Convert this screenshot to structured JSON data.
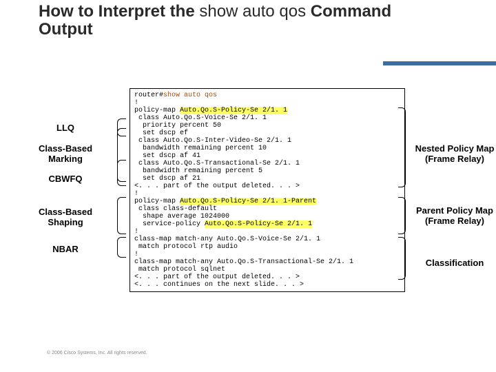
{
  "title": {
    "part1": "How to Interpret the ",
    "part2": "show auto qos ",
    "part3": "Command",
    "part4": "Output"
  },
  "leftLabels": {
    "llq": "LLQ",
    "marking": "Class-Based\nMarking",
    "cbwfq": "CBWFQ",
    "shaping": "Class-Based\nShaping",
    "nbar": "NBAR"
  },
  "rightLabels": {
    "nested": "Nested Policy Map\n(Frame Relay)",
    "parent": "Parent Policy Map\n(Frame Relay)",
    "classification": "Classification"
  },
  "code": {
    "l1a": "router#",
    "l1b": "show auto qos",
    "l2": "!",
    "l3a": "policy-map ",
    "l3b": "Auto.Qo.S-Policy-Se 2/1. 1",
    "l4": " class Auto.Qo.S-Voice-Se 2/1. 1",
    "l5": "  priority percent 50",
    "l6": "  set dscp ef",
    "l7": " class Auto.Qo.S-Inter-Video-Se 2/1. 1",
    "l8": "  bandwidth remaining percent 10",
    "l9": "  set dscp af 41",
    "l10": " class Auto.Qo.S-Transactional-Se 2/1. 1",
    "l11": "  bandwidth remaining percent 5",
    "l12": "  set dscp af 21",
    "l13": "<. . . part of the output deleted. . . >",
    "l14": "!",
    "l15a": "policy-map ",
    "l15b": "Auto.Qo.S-Policy-Se 2/1. 1-Parent",
    "l16": " class class-default",
    "l17": "  shape average 1024000",
    "l18a": "  service-policy ",
    "l18b": "Auto.Qo.S-Policy-Se 2/1. 1",
    "l19": "!",
    "l20": "class-map match-any Auto.Qo.S-Voice-Se 2/1. 1",
    "l21": " match protocol rtp audio",
    "l22": "!",
    "l23": "class-map match-any Auto.Qo.S-Transactional-Se 2/1. 1",
    "l24": " match protocol sqlnet",
    "l25": "<. . . part of the output deleted. . . >",
    "l26": "<. . . continues on the next slide. . . >"
  },
  "footer": "© 2006 Cisco Systems, Inc. All rights reserved."
}
